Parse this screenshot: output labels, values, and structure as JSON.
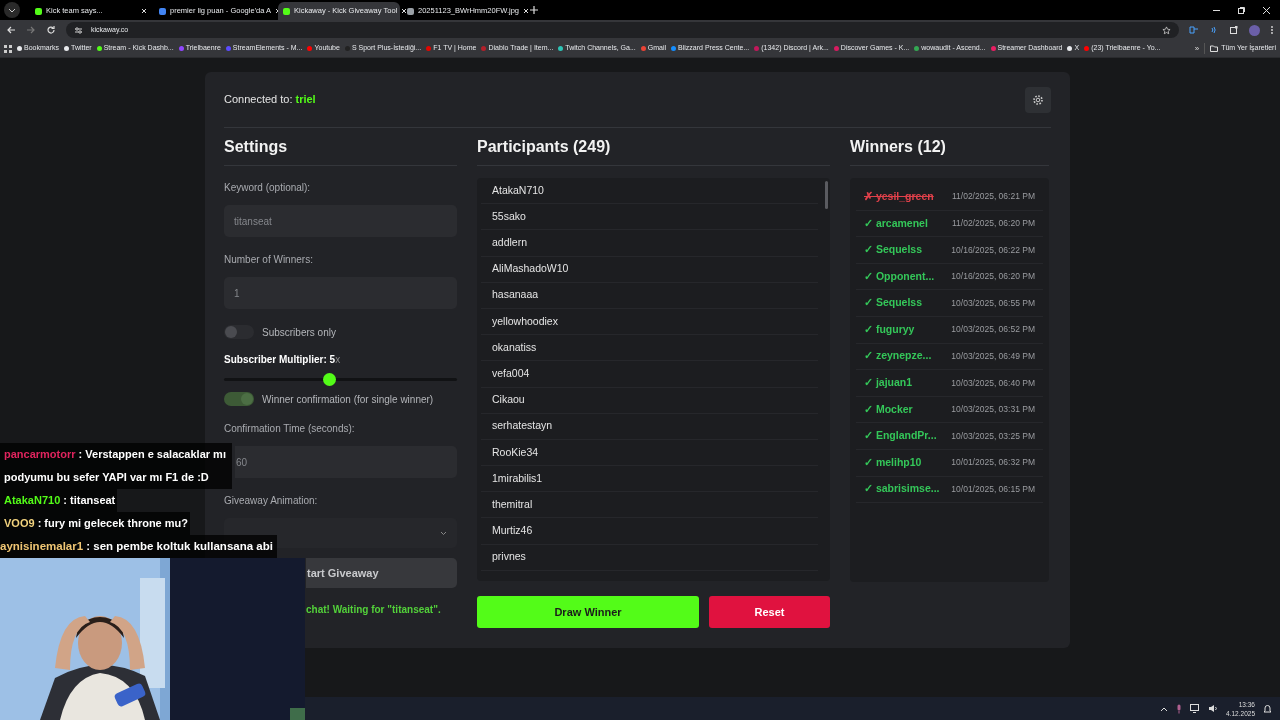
{
  "browser": {
    "tabs": [
      {
        "title": "Kick team says...",
        "selected": false,
        "color": "#53fc18"
      },
      {
        "title": "premier lig puan - Google'da A",
        "selected": false,
        "color": "#4285f4"
      },
      {
        "title": "Kickaway - Kick Giveaway Tool",
        "selected": true,
        "color": "#53fc18"
      },
      {
        "title": "20251123_BWrHmm20FW.jpg",
        "selected": false,
        "color": "#9aa0a6"
      }
    ],
    "address": "kickaway.co",
    "bookmarks": [
      {
        "title": "Bookmarks",
        "color": "#e8eaed"
      },
      {
        "title": "Twitter",
        "color": "#e8eaed"
      },
      {
        "title": "Stream - Kick Dashb...",
        "color": "#53fc18"
      },
      {
        "title": "Trielbaenre",
        "color": "#9146ff"
      },
      {
        "title": "StreamElements - M...",
        "color": "#5b4cff"
      },
      {
        "title": "Youtube",
        "color": "#ff0000"
      },
      {
        "title": "S Sport Plus-İstediği...",
        "color": "#222222"
      },
      {
        "title": "F1 TV | Home",
        "color": "#e10600"
      },
      {
        "title": "Diablo Trade | Item...",
        "color": "#b3202a"
      },
      {
        "title": "Twitch Channels, Ga...",
        "color": "#2ec4b6"
      },
      {
        "title": "Gmail",
        "color": "#ea4335"
      },
      {
        "title": "Blizzard Press Cente...",
        "color": "#148eff"
      },
      {
        "title": "(1342) Discord | Ark...",
        "color": "#c2185b"
      },
      {
        "title": "Discover Games - K...",
        "color": "#d81b60"
      },
      {
        "title": "wowaudit - Ascend...",
        "color": "#34a853"
      },
      {
        "title": "Streamer Dashboard",
        "color": "#e91e63"
      },
      {
        "title": "X",
        "color": "#e8eaed"
      },
      {
        "title": "(23) Trielbaenre - Yo...",
        "color": "#ff0000"
      }
    ],
    "overflow": "»",
    "all_bookmarks": "Tüm Yer İşaretleri"
  },
  "app": {
    "connected_label": "Connected to:",
    "channel": "triel",
    "settings": {
      "title": "Settings",
      "keyword_label": "Keyword (optional):",
      "keyword_placeholder": "titanseat",
      "winners_label": "Number of Winners:",
      "winners_placeholder": "1",
      "subscribers_only": {
        "label": "Subscribers only",
        "on": false
      },
      "multiplier_label": "**Subscriber Multiplier: 5**x",
      "multiplier": {
        "level": 0.45
      },
      "winner_confirmation": {
        "label": "Winner confirmation (for single winner)",
        "on": true
      },
      "confirmation_time_label": "Confirmation Time (seconds):",
      "confirmation_time_placeholder": "60",
      "animation_label": "Giveaway Animation:",
      "start_button": "tart Giveaway",
      "status": "chat! Waiting for \"titanseat\"."
    },
    "participants": {
      "title": "Participants (249)",
      "names": [
        "AtakaN710",
        "55sako",
        "addlern",
        "AliMashadoW10",
        "hasanaaa",
        "yellowhoodiex",
        "okanatiss",
        "vefa004",
        "Cikaou",
        "serhatestayn",
        "RooKie34",
        "1mirabilis1",
        "themitral",
        "Murtiz46",
        "privnes"
      ],
      "draw_button": "Draw Winner",
      "reset_button": "Reset"
    },
    "winners": {
      "title": "Winners (12)",
      "items": [
        {
          "rejected": true,
          "mark": "✗",
          "name": "yesil_green",
          "time": "11/02/2025, 06:21 PM"
        },
        {
          "rejected": false,
          "mark": "✓",
          "name": "arcamenel",
          "time": "11/02/2025, 06:20 PM"
        },
        {
          "rejected": false,
          "mark": "✓",
          "name": "Sequelss",
          "time": "10/16/2025, 06:22 PM"
        },
        {
          "rejected": false,
          "mark": "✓",
          "name": "Opponent...",
          "time": "10/16/2025, 06:20 PM"
        },
        {
          "rejected": false,
          "mark": "✓",
          "name": "Sequelss",
          "time": "10/03/2025, 06:55 PM"
        },
        {
          "rejected": false,
          "mark": "✓",
          "name": "fuguryy",
          "time": "10/03/2025, 06:52 PM"
        },
        {
          "rejected": false,
          "mark": "✓",
          "name": "zeynepze...",
          "time": "10/03/2025, 06:49 PM"
        },
        {
          "rejected": false,
          "mark": "✓",
          "name": "jajuan1",
          "time": "10/03/2025, 06:40 PM"
        },
        {
          "rejected": false,
          "mark": "✓",
          "name": "Mocker",
          "time": "10/03/2025, 03:31 PM"
        },
        {
          "rejected": false,
          "mark": "✓",
          "name": "EnglandPr...",
          "time": "10/03/2025, 03:25 PM"
        },
        {
          "rejected": false,
          "mark": "✓",
          "name": "melihp10",
          "time": "10/01/2025, 06:32 PM"
        },
        {
          "rejected": false,
          "mark": "✓",
          "name": "sabrisimse...",
          "time": "10/01/2025, 06:15 PM"
        }
      ]
    }
  },
  "chat": [
    {
      "user": "pancarmotorr",
      "color": "#e0245e",
      "message": ": Verstappen e salacaklar mı podyumu bu sefer YAPI var mı F1 de :D"
    },
    {
      "user": "AtakaN710",
      "color": "#53fc18",
      "message": ": titanseat"
    },
    {
      "user": "VOO9",
      "color": "#f3d37e",
      "message": ": fury mi gelecek throne mu?"
    },
    {
      "user": "aynisinemalar1",
      "color": "#f0c674",
      "message": ": sen pembe koltuk kullansana abi"
    }
  ],
  "taskbar": {
    "time": "13:36",
    "date": "4.12.2025"
  }
}
